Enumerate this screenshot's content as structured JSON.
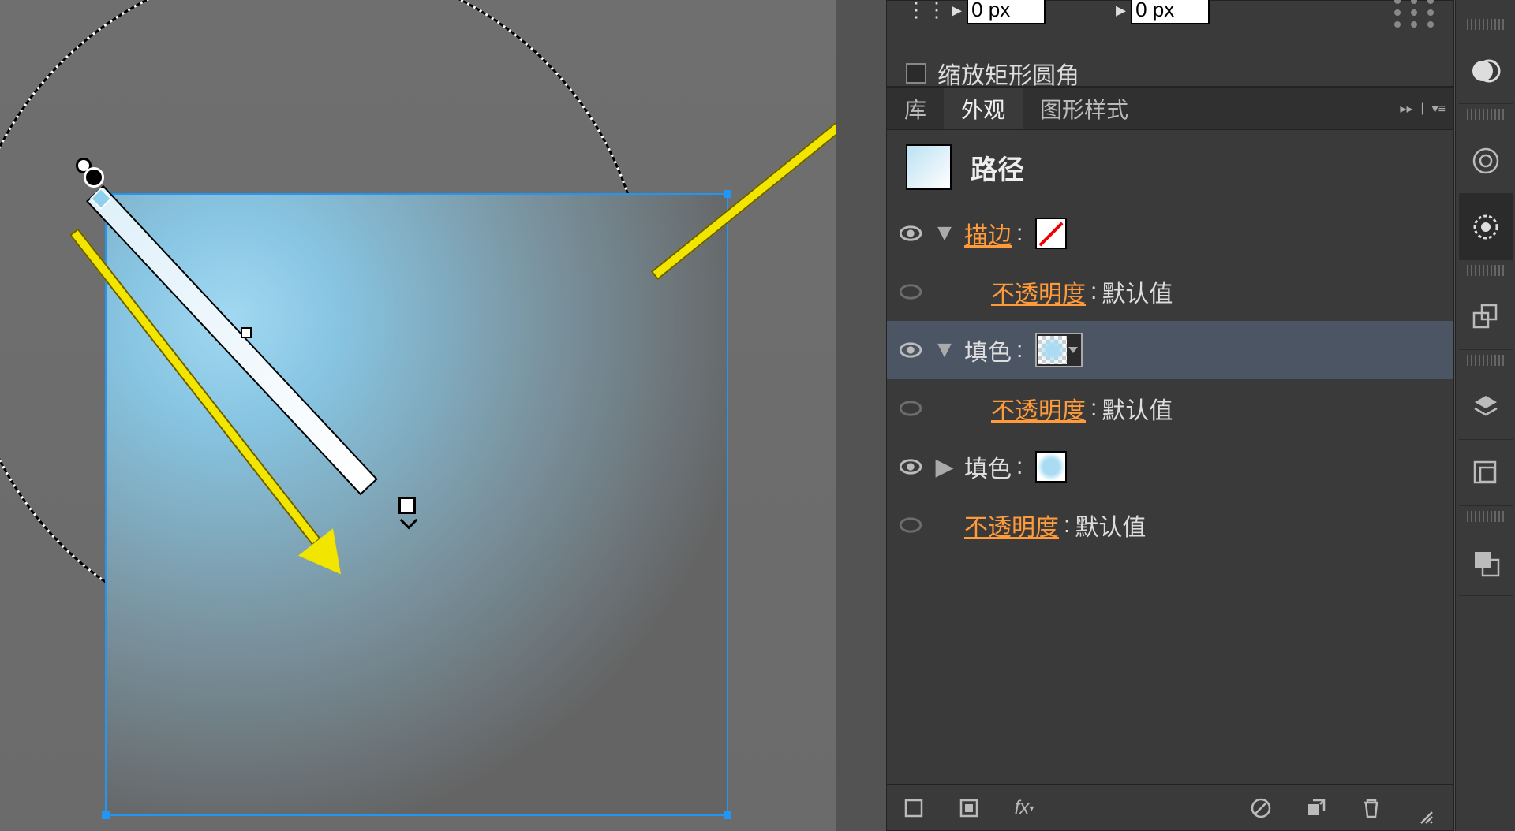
{
  "transform": {
    "x_value": "0 px",
    "y_value": "0 px",
    "scale_corners_label": "缩放矩形圆角"
  },
  "tabs": {
    "library": "库",
    "appearance": "外观",
    "graphic_styles": "图形样式"
  },
  "object": {
    "title": "路径"
  },
  "attrs": {
    "stroke_label": "描边",
    "fill_label": "填色",
    "opacity_label": "不透明度",
    "default_value": "默认值",
    "colon": ":"
  }
}
